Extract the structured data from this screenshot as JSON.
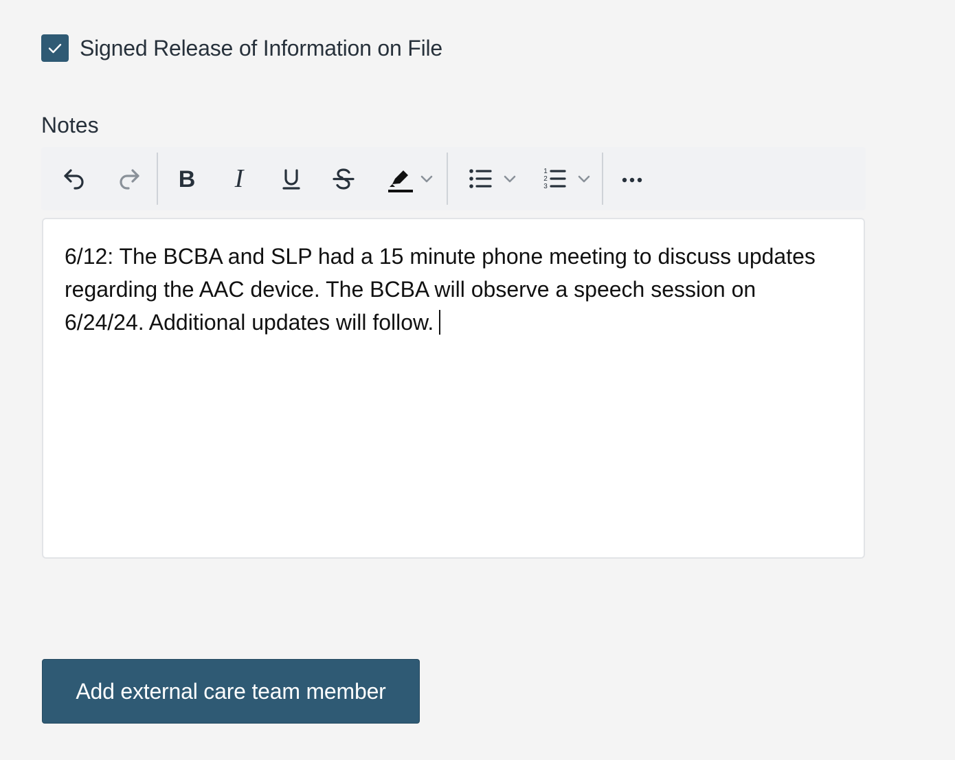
{
  "release": {
    "checked": true,
    "label": "Signed Release of Information on File"
  },
  "notes": {
    "label": "Notes",
    "content": "6/12: The BCBA and SLP had a 15 minute phone meeting to discuss updates regarding the AAC device. The BCBA will observe a speech session on 6/24/24. Additional updates will follow."
  },
  "toolbar": {
    "buttons": [
      {
        "name": "undo",
        "icon": "undo-icon"
      },
      {
        "name": "redo",
        "icon": "redo-icon"
      },
      {
        "name": "bold",
        "icon": "bold-icon"
      },
      {
        "name": "italic",
        "icon": "italic-icon"
      },
      {
        "name": "underline",
        "icon": "underline-icon"
      },
      {
        "name": "strikethrough",
        "icon": "strikethrough-icon"
      },
      {
        "name": "highlight",
        "icon": "highlighter-icon"
      },
      {
        "name": "bullet-list",
        "icon": "bullet-list-icon"
      },
      {
        "name": "numbered-list",
        "icon": "numbered-list-icon"
      },
      {
        "name": "more",
        "icon": "more-icon"
      }
    ],
    "colors": {
      "icon": "#27313b",
      "icon_disabled": "#8a9199",
      "background": "#f1f2f4"
    }
  },
  "actions": {
    "add_member_label": "Add external care team member"
  },
  "colors": {
    "accent": "#2f5a74",
    "background": "#f4f4f4",
    "text": "#27313b"
  }
}
